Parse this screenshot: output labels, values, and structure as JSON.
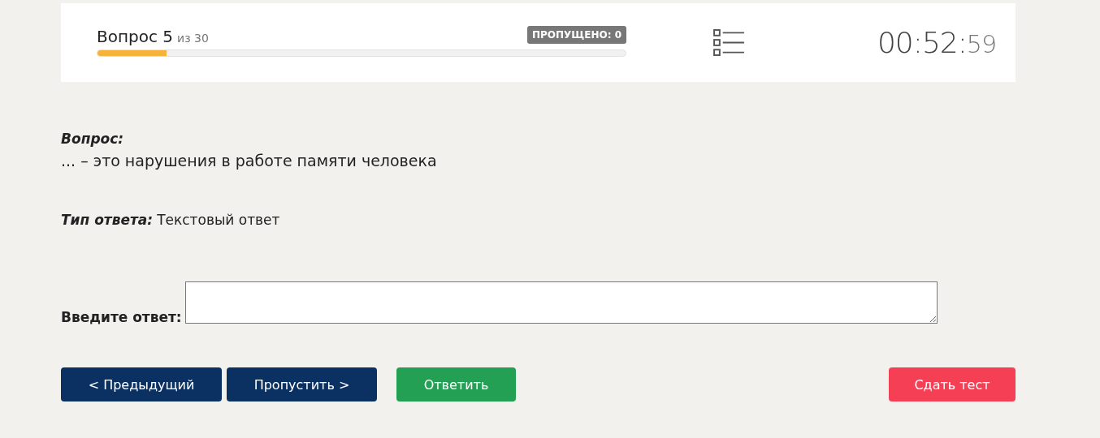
{
  "header": {
    "question_title": "Вопрос 5",
    "question_total": "из 30",
    "progress": {
      "level": 0.13
    },
    "skipped_badge": "ПРОПУЩЕНО: 0",
    "timer": {
      "main": "00:52:",
      "seconds": "59"
    }
  },
  "question": {
    "label": "Вопрос:",
    "text": "... – это нарушения в работе памяти человека"
  },
  "answer_type": {
    "label": "Тип ответа:",
    "value": "Текстовый ответ"
  },
  "answer_field": {
    "label": "Введите ответ:"
  },
  "buttons": [
    {
      "label": "< Предыдущий",
      "kind": "dark"
    },
    {
      "label": "Пропустить >",
      "kind": "dark"
    },
    {
      "label": "Ответить",
      "kind": "success"
    },
    {
      "label": "Сдать тест",
      "kind": "danger"
    }
  ]
}
